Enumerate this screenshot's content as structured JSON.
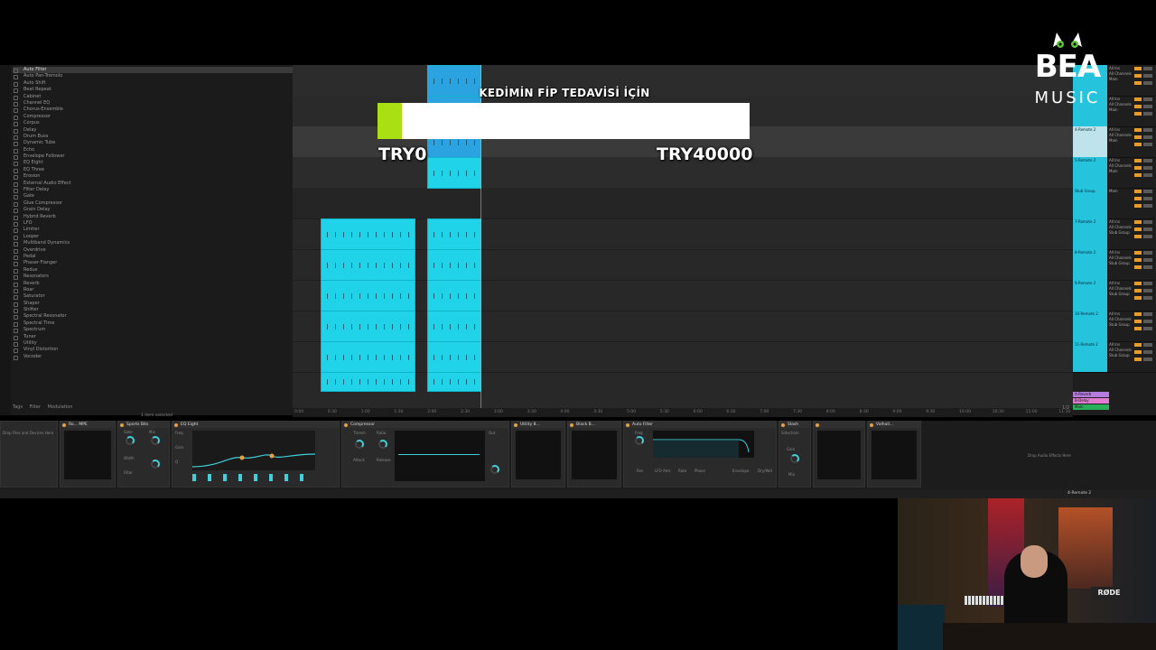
{
  "browser": {
    "items": [
      "Auto Filter",
      "Auto Pan-Tremolo",
      "Auto Shift",
      "Beat Repeat",
      "Cabinet",
      "Channel EQ",
      "Chorus-Ensemble",
      "Compressor",
      "Corpus",
      "Delay",
      "Drum Buss",
      "Dynamic Tube",
      "Echo",
      "Envelope Follower",
      "EQ Eight",
      "EQ Three",
      "Erosion",
      "External Audio Effect",
      "Filter Delay",
      "Gate",
      "Glue Compressor",
      "Grain Delay",
      "Hybrid Reverb",
      "LFO",
      "Limiter",
      "Looper",
      "Multiband Dynamics",
      "Overdrive",
      "Pedal",
      "Phaser-Flanger",
      "Redux",
      "Resonators",
      "Reverb",
      "Roar",
      "Saturator",
      "Shaper",
      "Shifter",
      "Spectral Resonator",
      "Spectral Time",
      "Spectrum",
      "Tuner",
      "Utility",
      "Vinyl Distortion",
      "Vocoder"
    ],
    "tabs": [
      "Tags",
      "Filter",
      "Modulation"
    ],
    "status": "1 item selected"
  },
  "ruler": {
    "ticks": [
      "0:00",
      "0:30",
      "1:00",
      "1:30",
      "2:00",
      "2:30",
      "3:00",
      "3:30",
      "4:00",
      "4:30",
      "5:00",
      "5:30",
      "6:00",
      "6:30",
      "7:00",
      "7:30",
      "8:00",
      "8:30",
      "9:00",
      "9:30",
      "10:00",
      "10:30",
      "11:00",
      "11:30"
    ]
  },
  "mixer": {
    "tracks": [
      {
        "name": "",
        "routing": [
          "All Ins",
          "All Channels",
          "Main"
        ],
        "color": "#26c4dc"
      },
      {
        "name": "",
        "routing": [
          "All Ins",
          "All Channels",
          "Main"
        ],
        "color": "#26c4dc"
      },
      {
        "name": "4-Remote 2",
        "routing": [
          "All Ins",
          "All Channels",
          "Main"
        ],
        "color": "#bfe3ea"
      },
      {
        "name": "5-Remote 2",
        "routing": [
          "All Ins",
          "All Channels",
          "Main"
        ],
        "color": "#26c4dc"
      },
      {
        "name": "Stub Group",
        "routing": [
          "Main"
        ],
        "color": "#26c4dc"
      },
      {
        "name": "7-Remote 2",
        "routing": [
          "All Ins",
          "All Channels",
          "Stub Group"
        ],
        "color": "#26c4dc"
      },
      {
        "name": "8-Remote 2",
        "routing": [
          "All Ins",
          "All Channels",
          "Stub Group"
        ],
        "color": "#26c4dc"
      },
      {
        "name": "9-Remote 2",
        "routing": [
          "All Ins",
          "All Channels",
          "Stub Group"
        ],
        "color": "#26c4dc"
      },
      {
        "name": "10-Remote 2",
        "routing": [
          "All Ins",
          "All Channels",
          "Stub Group"
        ],
        "color": "#26c4dc"
      },
      {
        "name": "11-Remote 2",
        "routing": [
          "All Ins",
          "All Channels",
          "Stub Group"
        ],
        "color": "#26c4dc"
      }
    ],
    "returns": [
      {
        "name": "A-Reverb",
        "color": "#b57be0"
      },
      {
        "name": "B-Delay",
        "color": "#e07bd0"
      },
      {
        "name": "Main",
        "color": "#2ab05a"
      }
    ],
    "main_page": "1/2"
  },
  "devices": {
    "chain": [
      {
        "title": "Ro... MPE"
      },
      {
        "title": "Sports Bits",
        "params": [
          "Gate",
          "Mix",
          "Width",
          "Filter"
        ]
      },
      {
        "title": "EQ Eight",
        "params": [
          "Freq",
          "Gain",
          "Q"
        ]
      },
      {
        "title": "Compressor",
        "params": [
          "Thresh",
          "Ratio",
          "Attack",
          "Release",
          "Out"
        ]
      },
      {
        "title": "Utility 8...",
        "params": []
      },
      {
        "title": "Black B...",
        "params": []
      },
      {
        "title": "Auto Filter",
        "params": [
          "Freq",
          "Res",
          "LFO Amt",
          "Rate",
          "Phase",
          "Envelope",
          "Dry/Wet"
        ]
      },
      {
        "title": "Slash",
        "params": [
          "Sidechain",
          "Gain",
          "Mix"
        ]
      },
      {
        "title": "Valhall...",
        "params": []
      }
    ],
    "drop_hint": "Drop Audio Effects Here",
    "track_label": "4-Remote 2"
  },
  "overlay": {
    "title": "KEDİMİN FİP TEDAVİSİ İÇİN",
    "min_label": "TRY0",
    "max_label": "TRY40000",
    "progress_fraction": 0.065,
    "fill_color": "#a8e014"
  },
  "logo": {
    "line1": "BEA",
    "line2": "MUSIC"
  },
  "webcam": {
    "mic_brand": "RØDE"
  },
  "colors": {
    "clip_cyan": "#21d3e8",
    "clip_blue": "#2ba3e0",
    "accent_orange": "#e8a03a"
  }
}
